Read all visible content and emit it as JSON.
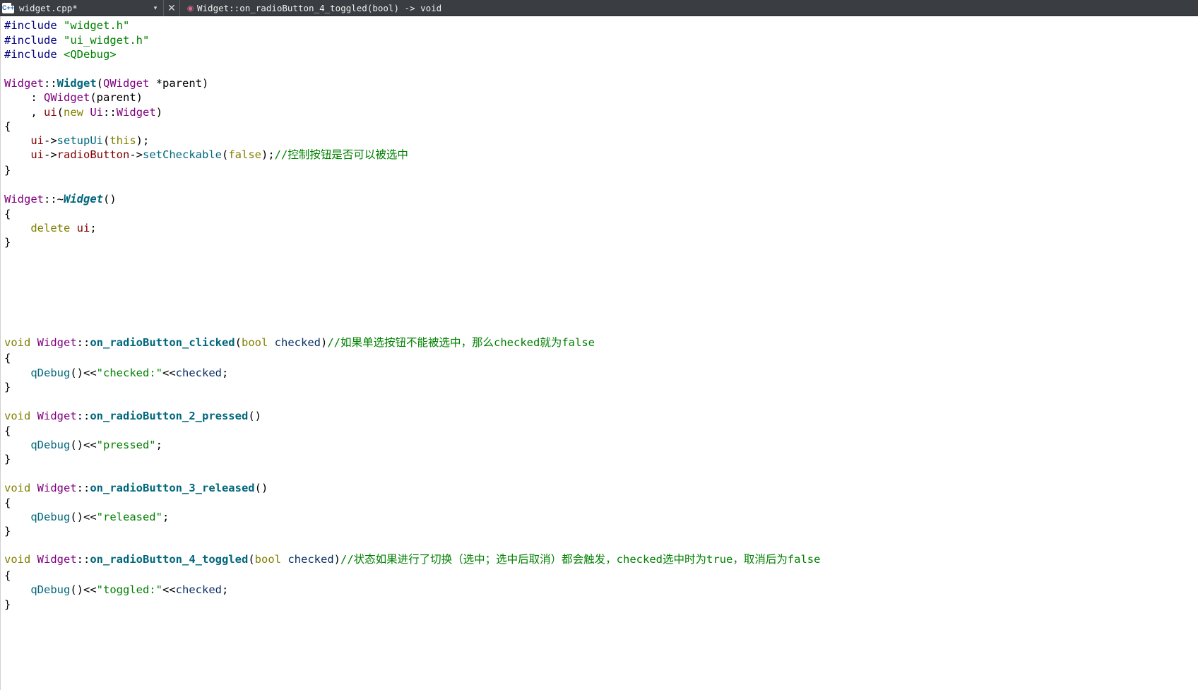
{
  "toolbar": {
    "file_icon": "c++-file-icon",
    "file_icon_label": "C++",
    "file_name": "widget.cpp*",
    "dropdown_glyph": "▾",
    "close_glyph": "✕",
    "symbol_icon": "function-symbol-icon",
    "current_symbol": "Widget::on_radioButton_4_toggled(bool) -> void"
  },
  "code": {
    "l1": [
      [
        "pp",
        "#include "
      ],
      [
        "str",
        "\"widget.h\""
      ]
    ],
    "l2": [
      [
        "pp",
        "#include "
      ],
      [
        "str",
        "\"ui_widget.h\""
      ]
    ],
    "l3": [
      [
        "pp",
        "#include "
      ],
      [
        "str",
        "<QDebug>"
      ]
    ],
    "l5": [
      [
        "cls",
        "Widget"
      ],
      [
        "",
        "::"
      ],
      [
        "fn",
        "Widget"
      ],
      [
        "",
        "("
      ],
      [
        "cls",
        "QWidget"
      ],
      [
        "",
        " *parent)"
      ]
    ],
    "l6": [
      [
        "",
        "    : "
      ],
      [
        "cls",
        "QWidget"
      ],
      [
        "",
        "(parent)"
      ]
    ],
    "l7": [
      [
        "",
        "    , "
      ],
      [
        "mem",
        "ui"
      ],
      [
        "",
        "("
      ],
      [
        "kw",
        "new"
      ],
      [
        "",
        " "
      ],
      [
        "cls",
        "Ui"
      ],
      [
        "",
        "::"
      ],
      [
        "cls",
        "Widget"
      ],
      [
        "",
        ")"
      ]
    ],
    "l8": [
      [
        "",
        "{"
      ]
    ],
    "l9": [
      [
        "",
        "    "
      ],
      [
        "mem",
        "ui"
      ],
      [
        "",
        "->"
      ],
      [
        "call",
        "setupUi"
      ],
      [
        "",
        "("
      ],
      [
        "kw",
        "this"
      ],
      [
        "",
        ");"
      ]
    ],
    "l10": [
      [
        "",
        "    "
      ],
      [
        "mem",
        "ui"
      ],
      [
        "",
        "->"
      ],
      [
        "mem",
        "radioButton"
      ],
      [
        "",
        "->"
      ],
      [
        "call",
        "setCheckable"
      ],
      [
        "",
        "("
      ],
      [
        "kw",
        "false"
      ],
      [
        "",
        ");"
      ],
      [
        "cmt",
        "//控制按钮是否可以被选中"
      ]
    ],
    "l11": [
      [
        "",
        "}"
      ]
    ],
    "l13": [
      [
        "cls",
        "Widget"
      ],
      [
        "",
        "::~"
      ],
      [
        "fni",
        "Widget"
      ],
      [
        "",
        "()"
      ]
    ],
    "l14": [
      [
        "",
        "{"
      ]
    ],
    "l15": [
      [
        "",
        "    "
      ],
      [
        "kw",
        "delete"
      ],
      [
        "",
        " "
      ],
      [
        "mem",
        "ui"
      ],
      [
        "",
        ";"
      ]
    ],
    "l16": [
      [
        "",
        "}"
      ]
    ],
    "l21": [
      [
        "kw",
        "void"
      ],
      [
        "",
        " "
      ],
      [
        "cls",
        "Widget"
      ],
      [
        "",
        "::"
      ],
      [
        "fn",
        "on_radioButton_clicked"
      ],
      [
        "",
        "("
      ],
      [
        "kw",
        "bool"
      ],
      [
        "",
        " "
      ],
      [
        "var",
        "checked"
      ],
      [
        "",
        ")"
      ],
      [
        "cmt",
        "//如果单选按钮不能被选中，那么checked就为false"
      ]
    ],
    "l22": [
      [
        "",
        "{"
      ]
    ],
    "l23": [
      [
        "",
        "    "
      ],
      [
        "call",
        "qDebug"
      ],
      [
        "",
        "()<<"
      ],
      [
        "str",
        "\"checked:\""
      ],
      [
        "",
        "<<"
      ],
      [
        "var",
        "checked"
      ],
      [
        "",
        ";"
      ]
    ],
    "l24": [
      [
        "",
        "}"
      ]
    ],
    "l26": [
      [
        "kw",
        "void"
      ],
      [
        "",
        " "
      ],
      [
        "cls",
        "Widget"
      ],
      [
        "",
        "::"
      ],
      [
        "fn",
        "on_radioButton_2_pressed"
      ],
      [
        "",
        "()"
      ]
    ],
    "l27": [
      [
        "",
        "{"
      ]
    ],
    "l28": [
      [
        "",
        "    "
      ],
      [
        "call",
        "qDebug"
      ],
      [
        "",
        "()<<"
      ],
      [
        "str",
        "\"pressed\""
      ],
      [
        "",
        ";"
      ]
    ],
    "l29": [
      [
        "",
        "}"
      ]
    ],
    "l31": [
      [
        "kw",
        "void"
      ],
      [
        "",
        " "
      ],
      [
        "cls",
        "Widget"
      ],
      [
        "",
        "::"
      ],
      [
        "fn",
        "on_radioButton_3_released"
      ],
      [
        "",
        "()"
      ]
    ],
    "l32": [
      [
        "",
        "{"
      ]
    ],
    "l33": [
      [
        "",
        "    "
      ],
      [
        "call",
        "qDebug"
      ],
      [
        "",
        "()<<"
      ],
      [
        "str",
        "\"released\""
      ],
      [
        "",
        ";"
      ]
    ],
    "l34": [
      [
        "",
        "}"
      ]
    ],
    "l36": [
      [
        "kw",
        "void"
      ],
      [
        "",
        " "
      ],
      [
        "cls",
        "Widget"
      ],
      [
        "",
        "::"
      ],
      [
        "fn",
        "on_radioButton_4_toggled"
      ],
      [
        "",
        "("
      ],
      [
        "kw",
        "bool"
      ],
      [
        "",
        " "
      ],
      [
        "var",
        "checked"
      ],
      [
        "",
        ")"
      ],
      [
        "cmt",
        "//状态如果进行了切换（选中；选中后取消）都会触发，checked选中时为true，取消后为false"
      ]
    ],
    "l37": [
      [
        "",
        "{"
      ]
    ],
    "l38": [
      [
        "",
        "    "
      ],
      [
        "call",
        "qDebug"
      ],
      [
        "",
        "()<<"
      ],
      [
        "str",
        "\"toggled:\""
      ],
      [
        "",
        "<<"
      ],
      [
        "var",
        "checked"
      ],
      [
        "",
        ";"
      ]
    ],
    "l39": [
      [
        "",
        "}"
      ]
    ]
  }
}
